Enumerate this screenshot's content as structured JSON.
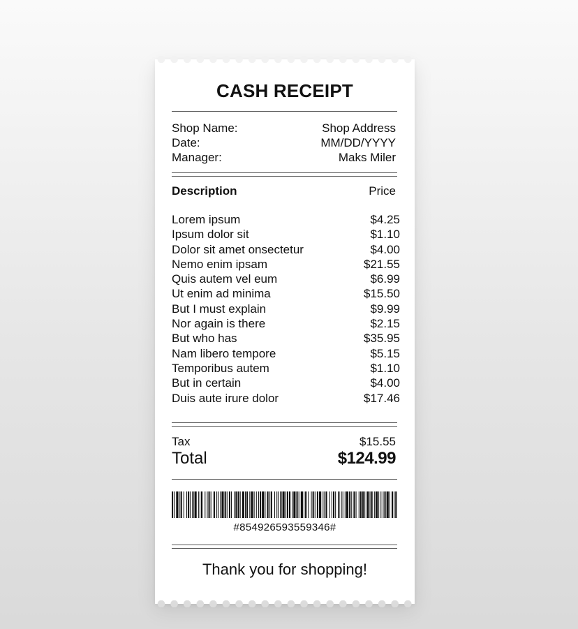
{
  "receipt": {
    "title": "CASH RECEIPT",
    "info": {
      "labels": [
        "Shop Name:",
        "Date:",
        "Manager:"
      ],
      "values": [
        "Shop Address",
        "MM/DD/YYYY",
        "Maks Miler"
      ]
    },
    "headers": {
      "description": "Description",
      "price": "Price"
    },
    "items": [
      {
        "name": "Lorem ipsum",
        "price": "$4.25"
      },
      {
        "name": "Ipsum dolor sit",
        "price": "$1.10"
      },
      {
        "name": "Dolor sit amet onsectetur",
        "price": "$4.00"
      },
      {
        "name": "Nemo enim ipsam",
        "price": "$21.55"
      },
      {
        "name": "Quis autem vel eum",
        "price": "$6.99"
      },
      {
        "name": "Ut enim ad minima",
        "price": "$15.50"
      },
      {
        "name": "But I must explain",
        "price": "$9.99"
      },
      {
        "name": "Nor again is there",
        "price": "$2.15"
      },
      {
        "name": "But who has",
        "price": "$35.95"
      },
      {
        "name": "Nam libero tempore",
        "price": "$5.15"
      },
      {
        "name": "Temporibus autem",
        "price": "$1.10"
      },
      {
        "name": "But in certain",
        "price": "$4.00"
      },
      {
        "name": "Duis aute irure dolor",
        "price": "$17.46"
      }
    ],
    "tax": {
      "label": "Tax",
      "value": "$15.55"
    },
    "total": {
      "label": "Total",
      "value": "$124.99"
    },
    "barcode_number": "#854926593559346#",
    "thanks": "Thank you for shopping!"
  },
  "colors": {
    "paper": "#ffffff",
    "ink": "#111111",
    "background": "#e6e6e6"
  }
}
